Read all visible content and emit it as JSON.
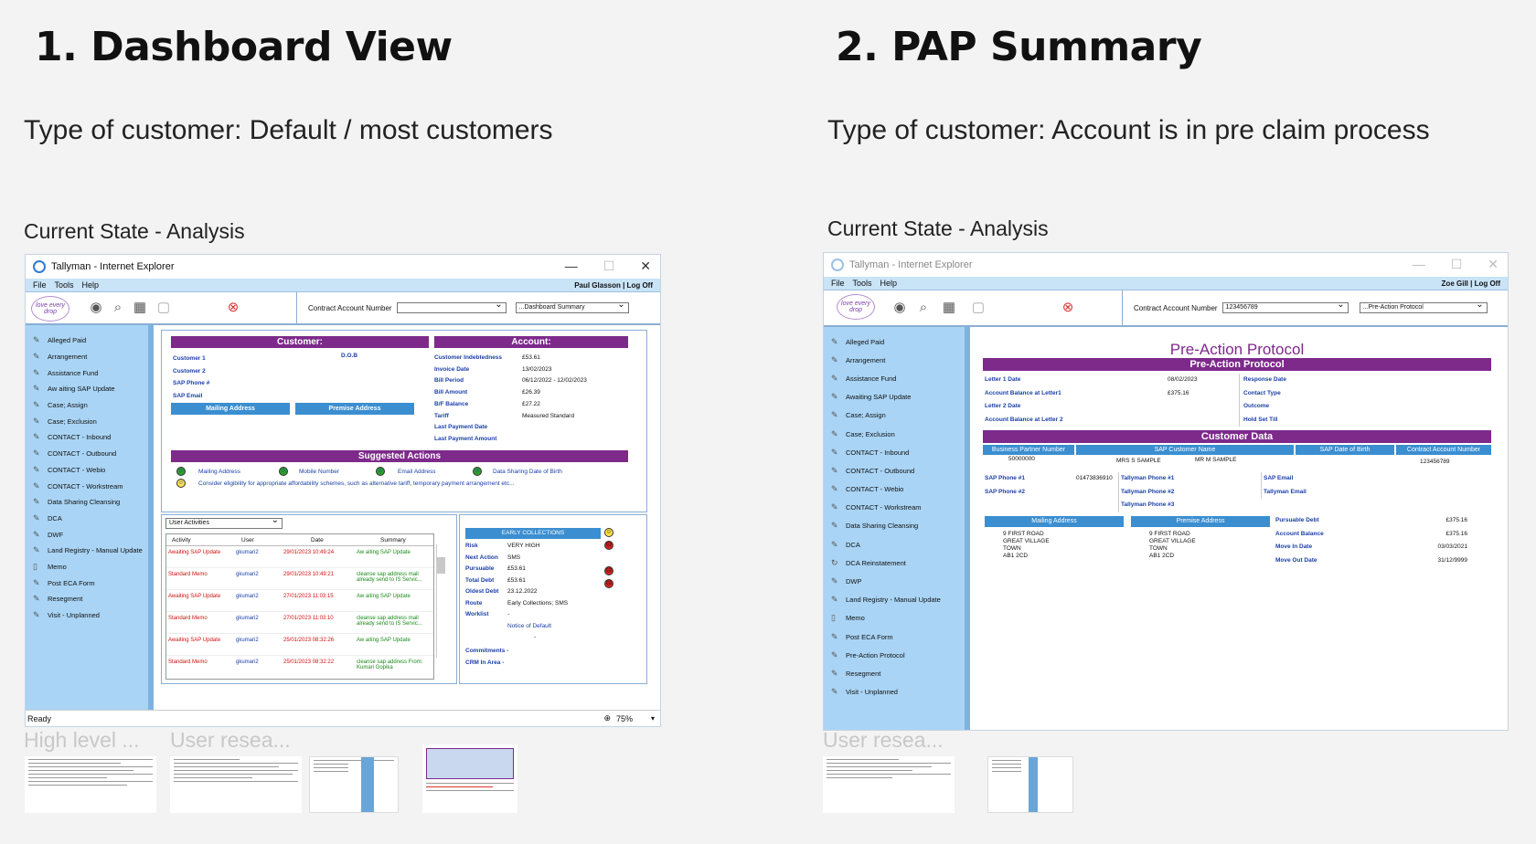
{
  "left": {
    "heading": "1. Dashboard View",
    "customer_type": "Type of customer: Default / most customers",
    "section": "Current State - Analysis",
    "window_title": "Tallyman - Internet Explorer",
    "menu": [
      "File",
      "Tools",
      "Help"
    ],
    "user": "Paul Glasson | Log Off",
    "contract_label": "Contract Account Number",
    "view_select": "...Dashboard Summary",
    "sidebar": [
      "Alleged Paid",
      "Arrangement",
      "Assistance Fund",
      "Aw aiting SAP Update",
      "Case; Assign",
      "Case; Exclusion",
      "CONTACT - Inbound",
      "CONTACT - Outbound",
      "CONTACT - Webio",
      "CONTACT - Workstream",
      "Data Sharing Cleansing",
      "DCA",
      "DWF",
      "Land Registry - Manual Update",
      "Memo",
      "Post ECA Form",
      "Resegment",
      "Visit - Unplanned"
    ],
    "customer_header": "Customer:",
    "customer_fields": [
      "Customer 1",
      "Customer 2",
      "SAP Phone #",
      "SAP Email"
    ],
    "dob_label": "D.O.B",
    "mailing_btn": "Mailing Address",
    "premise_btn": "Premise Address",
    "account_header": "Account:",
    "account_fields": [
      {
        "k": "Customer Indebtedness",
        "v": "£53.61"
      },
      {
        "k": "Invoice Date",
        "v": "13/02/2023"
      },
      {
        "k": "Bill Period",
        "v": "06/12/2022 - 12/02/2023"
      },
      {
        "k": "Bill Amount",
        "v": "£26.39"
      },
      {
        "k": "B/F Balance",
        "v": "£27.22"
      },
      {
        "k": "Tariff",
        "v": "Measured Standard"
      },
      {
        "k": "Last Payment Date",
        "v": ""
      },
      {
        "k": "Last Payment Amount",
        "v": ""
      }
    ],
    "suggested_header": "Suggested Actions",
    "suggested_items": [
      "Mailing Address",
      "Mobile Number",
      "Email Address",
      "Data Sharing Date of Birth"
    ],
    "suggested_note": "Consider eligibility for appropriate affordability schemes, such as alternative tariff, temporary payment arrangement etc...",
    "activities_select": "User Activities",
    "activity_headers": [
      "Activity",
      "User",
      "Date",
      "Summary"
    ],
    "activities": [
      {
        "a": "Awaiting SAP Update",
        "u": "gkumari2",
        "d": "29/01/2023 10:49:24",
        "s": "Aw aiting SAP Update"
      },
      {
        "a": "Standard Memo",
        "u": "gkumari2",
        "d": "29/01/2023 10:49:21",
        "s": "cleanse sap address mail already send to IS Servic..."
      },
      {
        "a": "Awaiting SAP Update",
        "u": "gkumari2",
        "d": "27/01/2023 11:03:15",
        "s": "Aw aiting SAP Update"
      },
      {
        "a": "Standard Memo",
        "u": "gkumari2",
        "d": "27/01/2023 11:03:10",
        "s": "cleanse sap address mail already send to IS Servic..."
      },
      {
        "a": "Awaiting SAP Update",
        "u": "gkumari2",
        "d": "25/01/2023 08:32:26",
        "s": "Aw aiting SAP Update"
      },
      {
        "a": "Standard Memo",
        "u": "gkumari2",
        "d": "25/01/2023 08:32:22",
        "s": "cleanse sap address From: Kumari Gopika"
      }
    ],
    "collections_header": "EARLY COLLECTIONS",
    "collections": [
      {
        "k": "Risk",
        "v": "VERY HIGH"
      },
      {
        "k": "Next Action",
        "v": "SMS"
      },
      {
        "k": "Pursuable",
        "v": "£53.61"
      },
      {
        "k": "Total Debt",
        "v": "£53.61"
      },
      {
        "k": "Oldest Debt",
        "v": "23.12.2022"
      },
      {
        "k": "Route",
        "v": "Early Collections; SMS"
      },
      {
        "k": "Worklist",
        "v": "-"
      },
      {
        "k": "",
        "v": "Notice of Default"
      },
      {
        "k": "",
        "v": "-"
      }
    ],
    "commitments": "Commitments -",
    "crm": "CRM In Area -",
    "status": "Ready",
    "zoom": "75%",
    "thumb_captions": [
      "High level ...",
      "User resea..."
    ]
  },
  "right": {
    "heading": "2. PAP Summary",
    "customer_type": "Type of customer: Account is in pre claim process",
    "section": "Current State - Analysis",
    "window_title": "Tallyman - Internet Explorer",
    "menu": [
      "File",
      "Tools",
      "Help"
    ],
    "user": "Zoe Gill | Log Off",
    "contract_label": "Contract Account Number",
    "contract_value": "123456789",
    "view_select": "...Pre-Action Protocol",
    "sidebar": [
      "Alleged Paid",
      "Arrangement",
      "Assistance Fund",
      "Awaiting SAP Update",
      "Case; Assign",
      "Case; Exclusion",
      "CONTACT - Inbound",
      "CONTACT - Outbound",
      "CONTACT - Webio",
      "CONTACT - Workstream",
      "Data Sharing Cleansing",
      "DCA",
      "DCA Reinstatement",
      "DWP",
      "Land Registry - Manual Update",
      "Memo",
      "Post ECA Form",
      "Pre-Action Protocol",
      "Resegment",
      "Visit - Unplanned"
    ],
    "pap_title": "Pre-Action Protocol",
    "pap_header": "Pre-Action Protocol",
    "pap_left": [
      {
        "k": "Letter 1 Date",
        "v": "08/02/2023"
      },
      {
        "k": "Account Balance at Letter1",
        "v": "£375.16"
      },
      {
        "k": "Letter 2 Date",
        "v": ""
      },
      {
        "k": "Account Balance at Letter 2",
        "v": ""
      }
    ],
    "pap_right": [
      "Response Date",
      "Contact Type",
      "Outcome",
      "Hold Set Till"
    ],
    "customer_data_header": "Customer Data",
    "cd_headers": [
      "Business Partner Number",
      "SAP Customer Name",
      "SAP Date of Birth",
      "Contract Account Number"
    ],
    "cd_values": [
      "50000000",
      "MRS S SAMPLE",
      "MR M SAMPLE",
      "123456789"
    ],
    "phones": [
      {
        "k": "SAP Phone #1",
        "v": "01473836910"
      },
      {
        "k": "SAP Phone #2",
        "v": ""
      }
    ],
    "tallyman_phones": [
      "Tallyman Phone #1",
      "Tallyman Phone #2",
      "Tallyman Phone #3"
    ],
    "emails": [
      "SAP Email",
      "Tallyman Email"
    ],
    "mailing_btn": "Mailing Address",
    "premise_btn": "Premise Address",
    "mailing_address": [
      "9 FIRST ROAD",
      "GREAT VILLAGE",
      "TOWN",
      "AB1 2CD"
    ],
    "premise_address": [
      "9 FIRST ROAD",
      "GREAT VILLAGE",
      "TOWN",
      "AB1 2CD"
    ],
    "balances": [
      {
        "k": "Pursuable Debt",
        "v": "£375.16"
      },
      {
        "k": "Account Balance",
        "v": "£375.16"
      },
      {
        "k": "Move In Date",
        "v": "03/03/2021"
      },
      {
        "k": "Move Out Date",
        "v": "31/12/9999"
      }
    ],
    "thumb_caption": "User resea..."
  },
  "colors": {
    "purple": "#7d2a8b",
    "sidebar": "#a9d4f5",
    "blue_button": "#3b8ed0",
    "background": "#f3f3f3"
  }
}
